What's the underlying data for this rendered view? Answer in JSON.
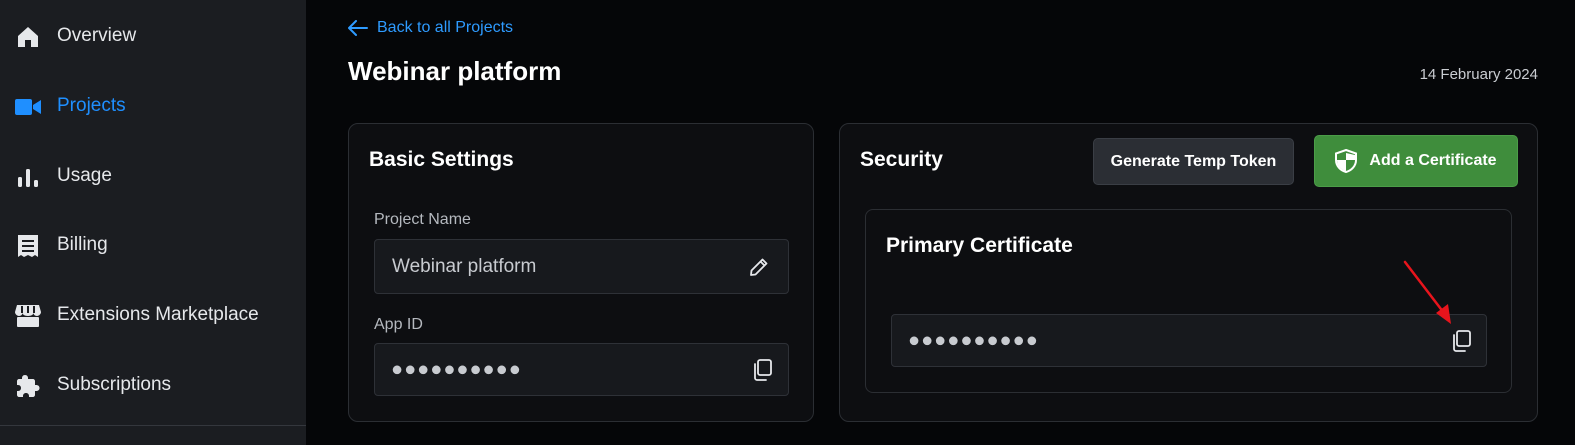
{
  "sidebar": {
    "items": [
      {
        "label": "Overview",
        "icon": "home-icon",
        "active": false
      },
      {
        "label": "Projects",
        "icon": "video-camera-icon",
        "active": true
      },
      {
        "label": "Usage",
        "icon": "bar-chart-icon",
        "active": false
      },
      {
        "label": "Billing",
        "icon": "receipt-icon",
        "active": false
      },
      {
        "label": "Extensions Marketplace",
        "icon": "store-icon",
        "active": false
      },
      {
        "label": "Subscriptions",
        "icon": "puzzle-icon",
        "active": false
      }
    ]
  },
  "header": {
    "back_label": "Back to all Projects",
    "title": "Webinar platform",
    "date": "14 February 2024"
  },
  "basic_settings": {
    "title": "Basic Settings",
    "project_name_label": "Project Name",
    "project_name_value": "Webinar platform",
    "app_id_label": "App ID",
    "app_id_value": "●●●●●●●●●●"
  },
  "security": {
    "title": "Security",
    "generate_token_label": "Generate Temp Token",
    "add_certificate_label": "Add a Certificate",
    "primary_certificate_title": "Primary Certificate",
    "primary_certificate_value": "●●●●●●●●●●"
  },
  "colors": {
    "accent": "#1f8fff",
    "success": "#3f8d3c",
    "annotation": "#e8141c"
  }
}
